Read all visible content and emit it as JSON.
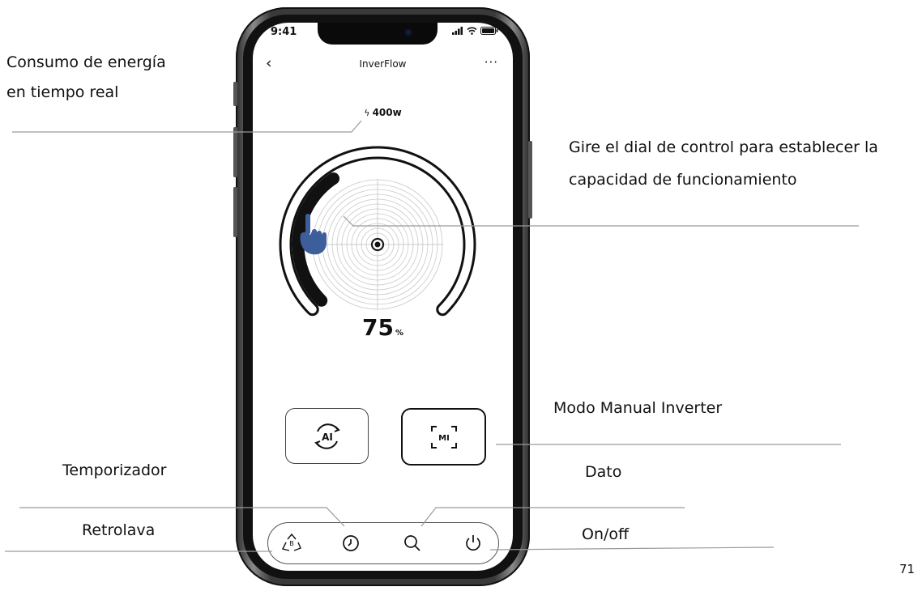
{
  "callouts": {
    "consumo_line1": "Consumo  de  energía",
    "consumo_line2": "en tiempo real",
    "dial_line1": "Gire el dial de control para establecer la",
    "dial_line2": "capacidad de funcionamiento",
    "modo_manual": "Modo Manual Inverter",
    "dato": "Dato",
    "temporizador": "Temporizador",
    "retrolava": "Retrolava",
    "onoff": "On/off"
  },
  "status_bar": {
    "time": "9:41",
    "icons": [
      "signal-icon",
      "wifi-icon",
      "battery-icon"
    ]
  },
  "app": {
    "title": "InverFlow",
    "back_icon": "chevron-left-icon",
    "more_label": "···",
    "power_value": "400w",
    "power_icon": "lightning-icon",
    "dial_percent": 75,
    "dial_percent_text": "75",
    "dial_unit": "%",
    "modes": [
      {
        "id": "ai",
        "label": "AI",
        "selected": false
      },
      {
        "id": "mi",
        "label": "MI",
        "selected": true
      }
    ],
    "bottom_bar": [
      "backwash-icon",
      "timer-icon",
      "search-icon",
      "power-icon"
    ],
    "recycle_letter": "B"
  },
  "colors": {
    "dial_arc": "#111111",
    "hand": "#3c5f9c",
    "leader_line": "#9a9a9a"
  },
  "page_number": "71"
}
